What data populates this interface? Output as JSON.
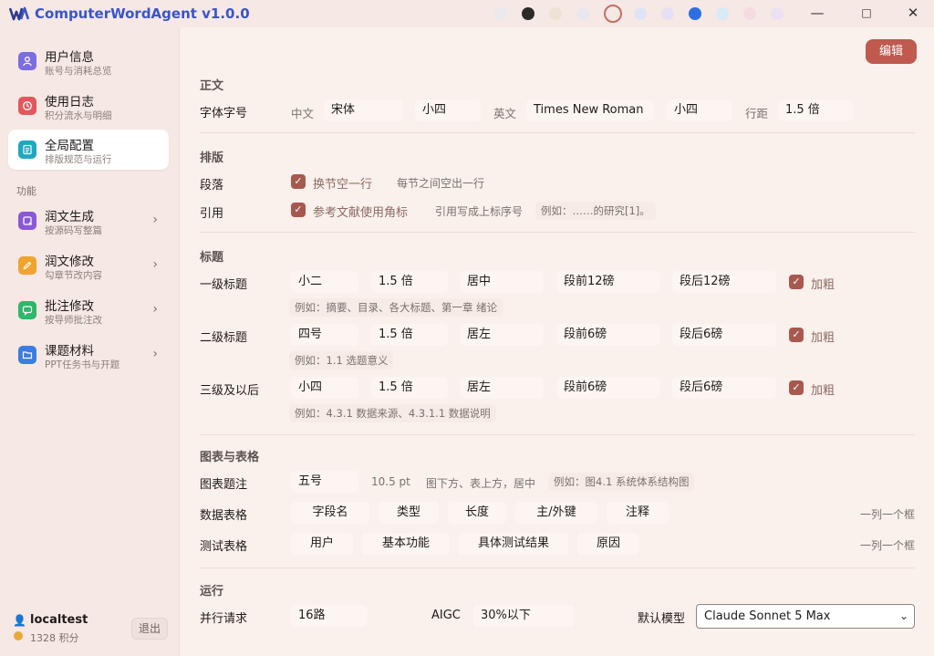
{
  "app": {
    "title": "ComputerWordAgent v1.0.0"
  },
  "theme": {
    "swatches": [
      "#e9e9ee",
      "#2b2b2b",
      "#eee2d4",
      "#e9e6ef",
      "#f6e8e4",
      "#dfe4f5",
      "#e7e0f5",
      "#2d6fe0",
      "#d7ebf5",
      "#f6dbe3",
      "#ece0f3"
    ],
    "selected_index": 4,
    "accent": "#c0594e"
  },
  "window": {
    "minimize": "—",
    "maximize": "□",
    "close": "✕"
  },
  "sidebar": {
    "items": [
      {
        "title": "用户信息",
        "sub": "账号与消耗总览",
        "icon": "user-icon",
        "color": "#7a6ee0"
      },
      {
        "title": "使用日志",
        "sub": "积分流水与明细",
        "icon": "clock-icon",
        "color": "#e2575e"
      },
      {
        "title": "全局配置",
        "sub": "排版规范与运行",
        "icon": "document-icon",
        "color": "#1fa7c2"
      }
    ],
    "section_label": "功能",
    "features": [
      {
        "title": "润文生成",
        "sub": "按源码写整篇",
        "icon": "generate-icon",
        "color": "#8a58d8"
      },
      {
        "title": "润文修改",
        "sub": "勾章节改内容",
        "icon": "pencil-icon",
        "color": "#f0a32e"
      },
      {
        "title": "批注修改",
        "sub": "按导师批注改",
        "icon": "comment-icon",
        "color": "#2db86a"
      },
      {
        "title": "课题材料",
        "sub": "PPT任务书与开题",
        "icon": "folder-icon",
        "color": "#3b7de0"
      }
    ],
    "user": {
      "name": "localtest",
      "points": "1328 积分",
      "logout": "退出"
    }
  },
  "main": {
    "edit_button": "编辑",
    "body": {
      "section": "正文",
      "font_row_label": "字体字号",
      "cn_label": "中文",
      "cn_font": "宋体",
      "cn_size": "小四",
      "en_label": "英文",
      "en_font": "Times New Roman",
      "en_size": "小四",
      "spacing_label": "行距",
      "spacing": "1.5 倍"
    },
    "layout": {
      "section": "排版",
      "para_label": "段落",
      "para_check": "换节空一行",
      "para_note": "每节之间空出一行",
      "cite_label": "引用",
      "cite_check": "参考文献使用角标",
      "cite_note": "引用写成上标序号",
      "cite_example": "例如：……的研究[1]。"
    },
    "headings": {
      "section": "标题",
      "rows": [
        {
          "label": "一级标题",
          "size": "小二",
          "spacing": "1.5 倍",
          "align": "居中",
          "before": "段前12磅",
          "after": "段后12磅",
          "bold": "加粗",
          "example": "例如：摘要、目录、各大标题、第一章 绪论"
        },
        {
          "label": "二级标题",
          "size": "四号",
          "spacing": "1.5 倍",
          "align": "居左",
          "before": "段前6磅",
          "after": "段后6磅",
          "bold": "加粗",
          "example": "例如：1.1 选题意义"
        },
        {
          "label": "三级及以后",
          "size": "小四",
          "spacing": "1.5 倍",
          "align": "居左",
          "before": "段前6磅",
          "after": "段后6磅",
          "bold": "加粗",
          "example": "例如：4.3.1 数据来源、4.3.1.1 数据说明"
        }
      ]
    },
    "tables": {
      "section": "图表与表格",
      "caption_label": "图表题注",
      "caption_size": "五号",
      "caption_pt": "10.5 pt",
      "caption_pos": "图下方、表上方，居中",
      "caption_example": "例如：图4.1 系统体系结构图",
      "data_label": "数据表格",
      "data_cols": [
        "字段名",
        "类型",
        "长度",
        "主/外键",
        "注释"
      ],
      "data_note": "一列一个框",
      "test_label": "测试表格",
      "test_cols": [
        "用户",
        "基本功能",
        "具体测试结果",
        "原因"
      ],
      "test_note": "一列一个框"
    },
    "run": {
      "section": "运行",
      "parallel_label": "并行请求",
      "parallel": "16路",
      "aigc_label": "AIGC",
      "aigc": "30%以下",
      "model_label": "默认模型",
      "model": "Claude Sonnet 5 Max"
    }
  }
}
